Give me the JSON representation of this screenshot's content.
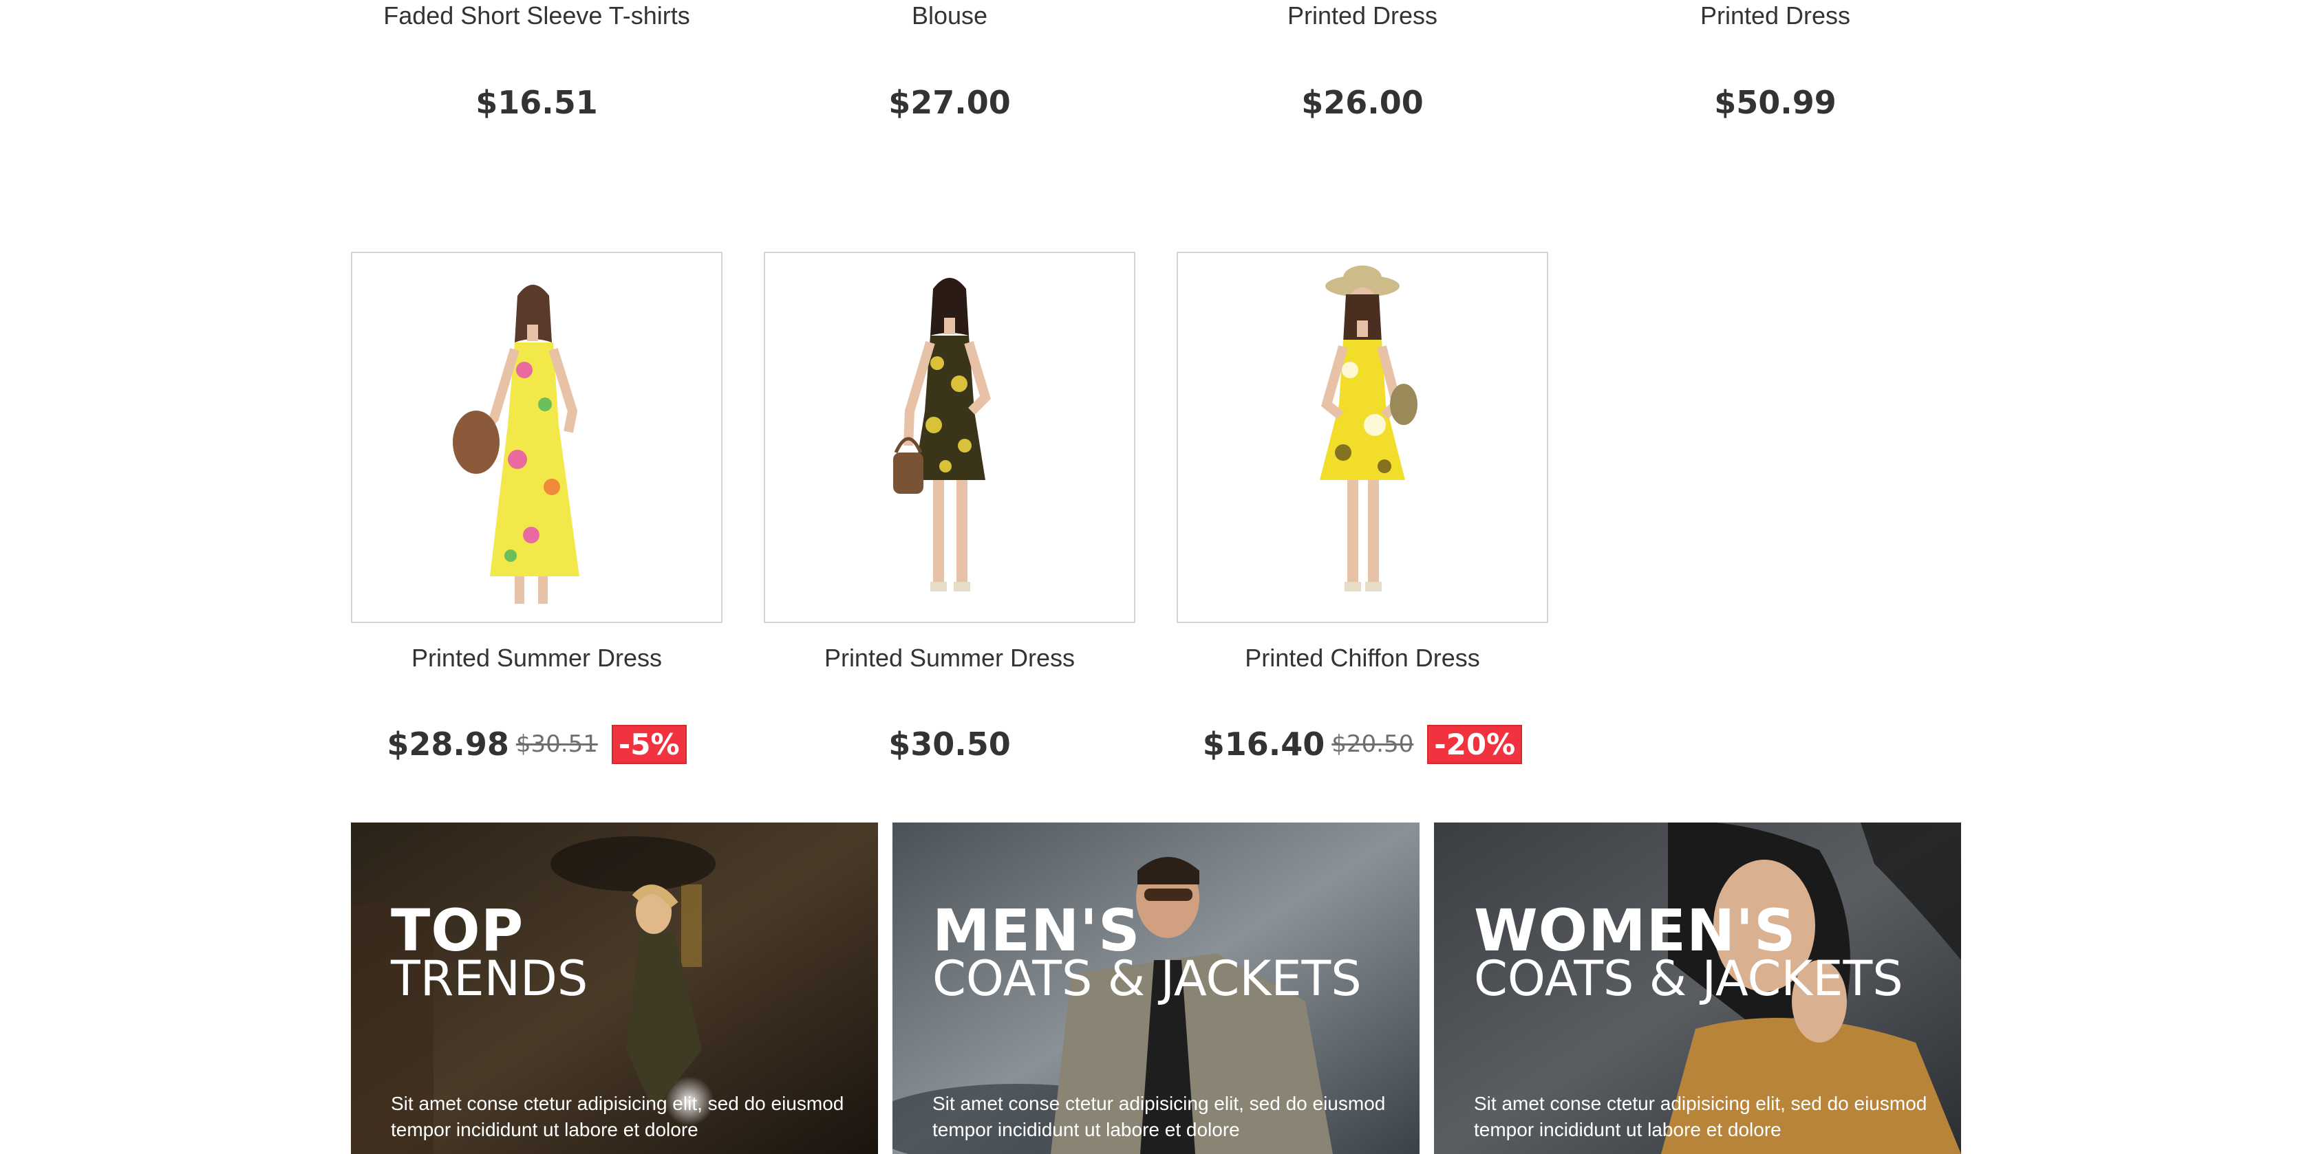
{
  "top_products": [
    {
      "name": "Faded Short Sleeve T-shirts",
      "price": "$16.51"
    },
    {
      "name": "Blouse",
      "price": "$27.00"
    },
    {
      "name": "Printed Dress",
      "price": "$26.00"
    },
    {
      "name": "Printed Dress",
      "price": "$50.99"
    }
  ],
  "products": [
    {
      "name": "Printed Summer Dress",
      "price": "$28.98",
      "old_price": "$30.51",
      "discount": "-5%",
      "image_icon": "dress-yellow-floral-long"
    },
    {
      "name": "Printed Summer Dress",
      "price": "$30.50",
      "image_icon": "dress-black-yellow-short"
    },
    {
      "name": "Printed Chiffon Dress",
      "price": "$16.40",
      "old_price": "$20.50",
      "discount": "-20%",
      "image_icon": "dress-yellow-chiffon-hat"
    }
  ],
  "banners": [
    {
      "title_bold": "TOP",
      "title_light": "TRENDS",
      "text": "Sit amet conse ctetur adipisicing elit, sed do eiusmod tempor incididunt ut labore et dolore"
    },
    {
      "title_bold": "MEN'S",
      "title_light": "COATS & JACKETS",
      "text": "Sit amet conse ctetur adipisicing elit, sed do eiusmod tempor incididunt ut labore et dolore"
    },
    {
      "title_bold": "WOMEN'S",
      "title_light": "COATS & JACKETS",
      "text": "Sit amet conse ctetur adipisicing elit, sed do eiusmod tempor incididunt ut labore et dolore"
    }
  ],
  "colors": {
    "discount_badge": "#f13340",
    "text": "#333333",
    "old_price": "#6f6f6f",
    "border": "#d6d4d4"
  }
}
